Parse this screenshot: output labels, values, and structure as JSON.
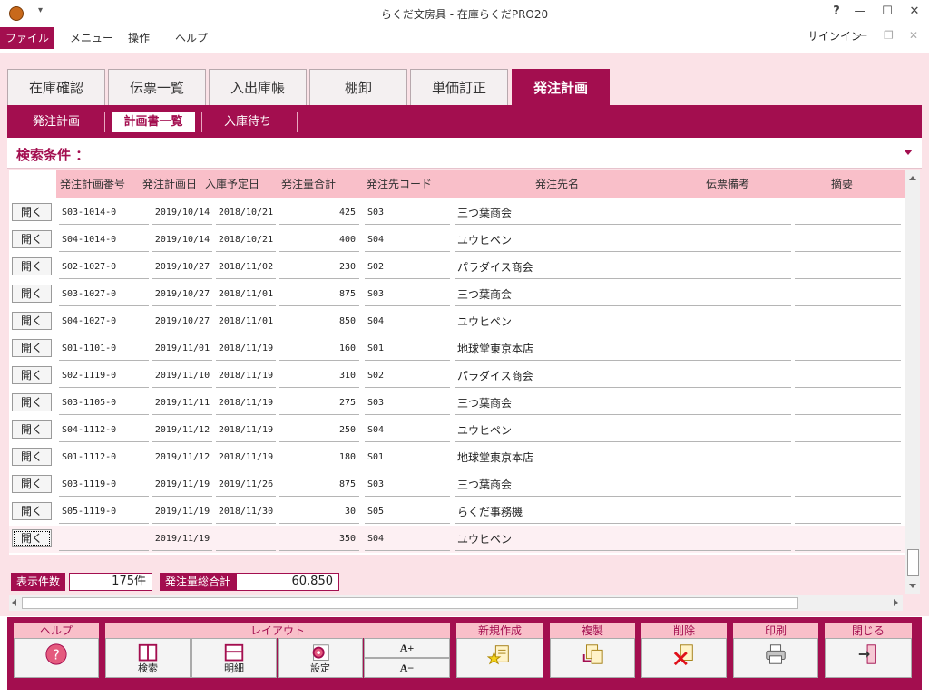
{
  "window": {
    "title": "らくだ文房具 - 在庫らくだPRO20",
    "help": "?",
    "minimize": "—",
    "maximize": "☐",
    "close": "✕"
  },
  "menu": {
    "file": "ファイル",
    "items": [
      "メニュー",
      "操作",
      "ヘルプ"
    ],
    "signin": "サインイン"
  },
  "tabs": [
    "在庫確認",
    "伝票一覧",
    "入出庫帳",
    "棚卸",
    "単価訂正",
    "発注計画"
  ],
  "active_tab": "発注計画",
  "subtabs": [
    "発注計画",
    "計画書一覧",
    "入庫待ち"
  ],
  "active_subtab": "計画書一覧",
  "search": {
    "label": "検索条件 ："
  },
  "table": {
    "open_label": "開く",
    "columns": [
      "発注計画番号",
      "発注計画日",
      "入庫予定日",
      "発注量合計",
      "発注先コード",
      "発注先名",
      "伝票備考",
      "摘要"
    ],
    "rows": [
      [
        "S03-1014-0",
        "2019/10/14",
        "2018/10/21",
        "425",
        "S03",
        "三つ葉商会",
        "",
        ""
      ],
      [
        "S04-1014-0",
        "2019/10/14",
        "2018/10/21",
        "400",
        "S04",
        "ユウヒペン",
        "",
        ""
      ],
      [
        "S02-1027-0",
        "2019/10/27",
        "2018/11/02",
        "230",
        "S02",
        "パラダイス商会",
        "",
        ""
      ],
      [
        "S03-1027-0",
        "2019/10/27",
        "2018/11/01",
        "875",
        "S03",
        "三つ葉商会",
        "",
        ""
      ],
      [
        "S04-1027-0",
        "2019/10/27",
        "2018/11/01",
        "850",
        "S04",
        "ユウヒペン",
        "",
        ""
      ],
      [
        "S01-1101-0",
        "2019/11/01",
        "2018/11/19",
        "160",
        "S01",
        "地球堂東京本店",
        "",
        ""
      ],
      [
        "S02-1119-0",
        "2019/11/10",
        "2018/11/19",
        "310",
        "S02",
        "パラダイス商会",
        "",
        ""
      ],
      [
        "S03-1105-0",
        "2019/11/11",
        "2018/11/19",
        "275",
        "S03",
        "三つ葉商会",
        "",
        ""
      ],
      [
        "S04-1112-0",
        "2019/11/12",
        "2018/11/19",
        "250",
        "S04",
        "ユウヒペン",
        "",
        ""
      ],
      [
        "S01-1112-0",
        "2019/11/12",
        "2018/11/19",
        "180",
        "S01",
        "地球堂東京本店",
        "",
        ""
      ],
      [
        "S03-1119-0",
        "2019/11/19",
        "2019/11/26",
        "875",
        "S03",
        "三つ葉商会",
        "",
        ""
      ],
      [
        "S05-1119-0",
        "2019/11/19",
        "2018/11/30",
        "30",
        "S05",
        "らくだ事務機",
        "",
        ""
      ],
      [
        "",
        "2019/11/19",
        "",
        "350",
        "S04",
        "ユウヒペン",
        "",
        ""
      ]
    ]
  },
  "totals": {
    "count_label": "表示件数",
    "count_value": "175件",
    "sum_label": "発注量総合計",
    "sum_value": "60,850"
  },
  "footer": {
    "help_group": "ヘルプ",
    "layout_group": "レイアウト",
    "new_group": "新規作成",
    "copy_group": "複製",
    "delete_group": "削除",
    "print_group": "印刷",
    "close_group": "閉じる",
    "search_btn": "検索",
    "detail_btn": "明細",
    "settings_btn": "設定",
    "font_up": "A+",
    "font_down": "A−"
  },
  "colors": {
    "accent": "#a30e4f",
    "header_pink": "#f9bfc9",
    "background_pink": "#fbe2e7"
  }
}
